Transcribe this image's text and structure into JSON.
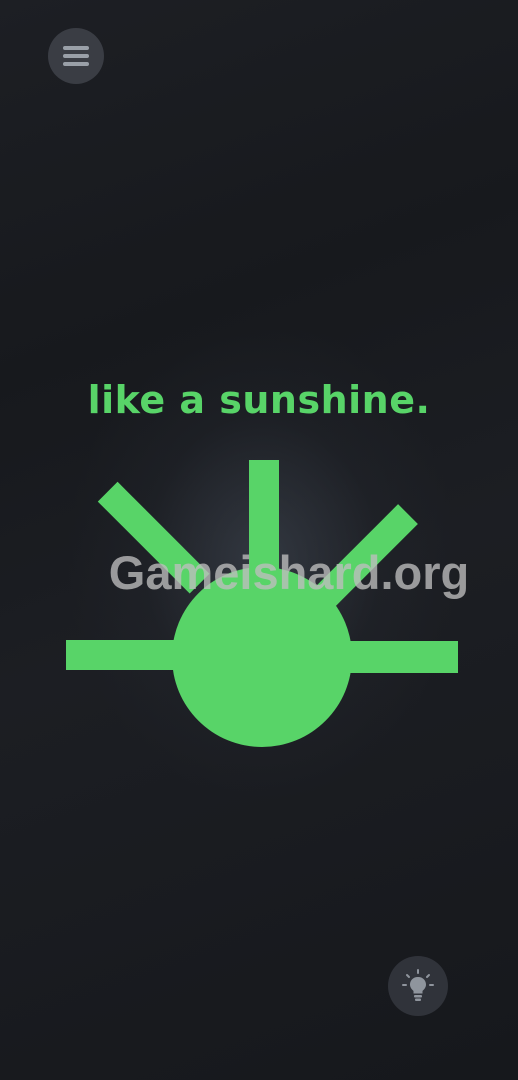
{
  "game": {
    "caption": "like a sunshine.",
    "watermark": "Gameishard.org",
    "colors": {
      "accent": "#58d468",
      "background": "#1a1c21",
      "button_bg": "#3a3d44",
      "icon": "#9aa0a8"
    }
  },
  "controls": {
    "menu_icon": "hamburger-menu-icon",
    "hint_icon": "lightbulb-icon"
  }
}
